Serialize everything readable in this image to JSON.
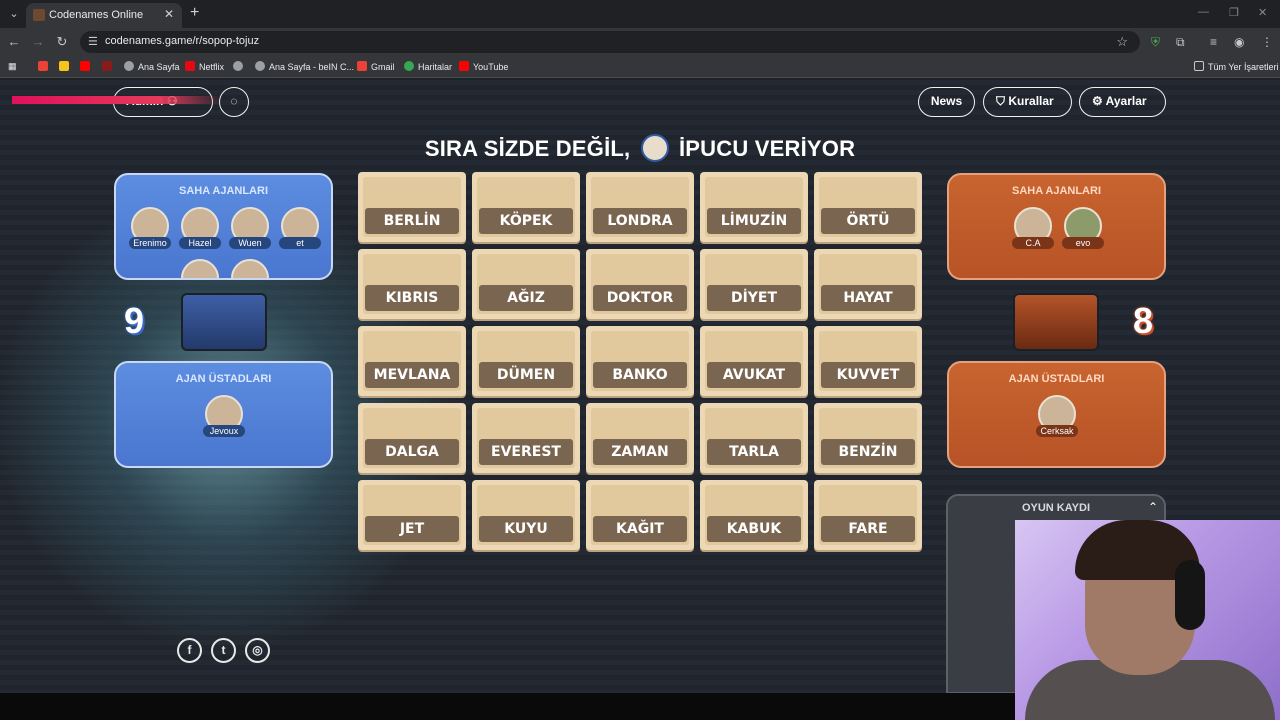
{
  "browser": {
    "tab_title": "Codenames Online",
    "url": "codenames.game/r/sopop-tojuz",
    "bookmarks": [
      "Ana Sayfa",
      "Netflix",
      "Ana Sayfa - beIN C...",
      "Gmail",
      "Haritalar",
      "YouTube"
    ],
    "all_bookmarks": "Tüm Yer İşaretleri"
  },
  "header": {
    "admin_label": "Admin",
    "news_label": "News",
    "rules_label": "Kurallar",
    "settings_label": "Ayarlar",
    "status_before": "SIRA SİZDE DEĞİL,",
    "status_after": "İPUCU VERİYOR",
    "status_avatar_name": "Jevoux"
  },
  "blue_team": {
    "color": "#5585dc",
    "score": "9",
    "operatives_title": "SAHA AJANLARI",
    "operatives": [
      "Erenimo",
      "Hazel",
      "Wuen",
      "et"
    ],
    "spymasters_title": "AJAN ÜSTADLARI",
    "spymaster": "Jevoux"
  },
  "red_team": {
    "color": "#c15c2b",
    "score": "8",
    "operatives_title": "SAHA AJANLARI",
    "operatives": [
      "C.A",
      "evo"
    ],
    "spymasters_title": "AJAN ÜSTADLARI",
    "spymaster": "Cerksak"
  },
  "board": {
    "words": [
      [
        "BERLİN",
        "KÖPEK",
        "LONDRA",
        "LİMUZİN",
        "ÖRTÜ"
      ],
      [
        "KIBRIS",
        "AĞIZ",
        "DOKTOR",
        "DİYET",
        "HAYAT"
      ],
      [
        "MEVLANA",
        "DÜMEN",
        "BANKO",
        "AVUKAT",
        "KUVVET"
      ],
      [
        "DALGA",
        "EVEREST",
        "ZAMAN",
        "TARLA",
        "BENZİN"
      ],
      [
        "JET",
        "KUYU",
        "KAĞIT",
        "KABUK",
        "FARE"
      ]
    ]
  },
  "game_log": {
    "title": "OYUN KAYDI"
  },
  "icons": {
    "facebook": "facebook-icon",
    "twitter": "twitter-icon",
    "instagram": "instagram-icon"
  }
}
